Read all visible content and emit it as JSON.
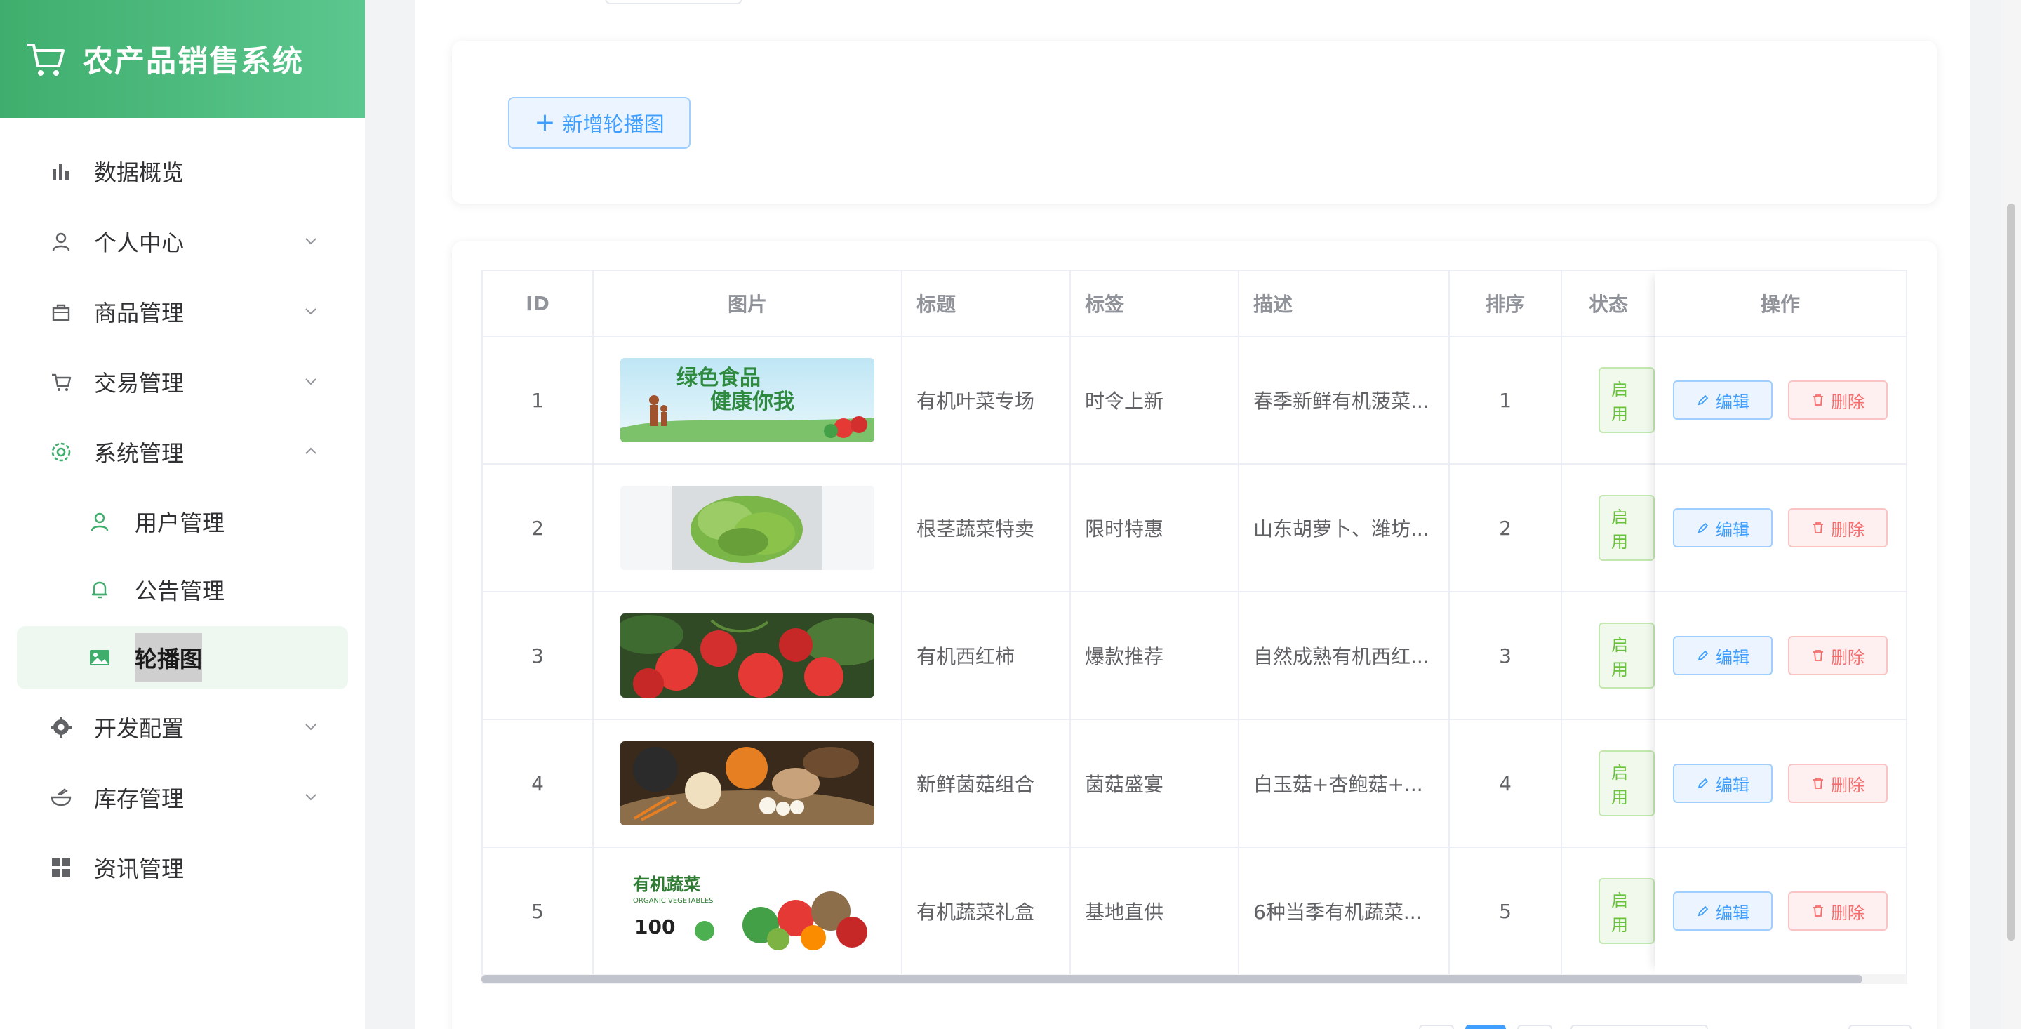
{
  "app": {
    "title": "农产品销售系统"
  },
  "sidebar": {
    "items": [
      {
        "label": "数据概览",
        "icon": "bar-chart-icon",
        "expandable": false
      },
      {
        "label": "个人中心",
        "icon": "user-icon",
        "expandable": true
      },
      {
        "label": "商品管理",
        "icon": "bag-icon",
        "expandable": true
      },
      {
        "label": "交易管理",
        "icon": "cart-icon",
        "expandable": true
      },
      {
        "label": "系统管理",
        "icon": "gear-icon",
        "expandable": true,
        "expanded": true,
        "children": [
          {
            "label": "用户管理",
            "icon": "user-icon"
          },
          {
            "label": "公告管理",
            "icon": "bell-icon"
          },
          {
            "label": "轮播图",
            "icon": "image-icon",
            "active": true
          }
        ]
      },
      {
        "label": "开发配置",
        "icon": "gear-icon",
        "expandable": true
      },
      {
        "label": "库存管理",
        "icon": "bowl-icon",
        "expandable": true
      },
      {
        "label": "资讯管理",
        "icon": "grid-icon",
        "expandable": false
      }
    ]
  },
  "toolbar": {
    "add_label": "新增轮播图"
  },
  "table": {
    "headers": {
      "id": "ID",
      "image": "图片",
      "title": "标题",
      "tag": "标签",
      "desc": "描述",
      "sort": "排序",
      "status": "状态",
      "actions": "操作"
    },
    "rows": [
      {
        "id": "1",
        "image": "绿色食品 健康你我",
        "title": "有机叶菜专场",
        "tag": "时令上新",
        "desc": "春季新鲜有机菠菜...",
        "sort": "1",
        "status": "启用"
      },
      {
        "id": "2",
        "image": "lettuce",
        "title": "根茎蔬菜特卖",
        "tag": "限时特惠",
        "desc": "山东胡萝卜、潍坊...",
        "sort": "2",
        "status": "启用"
      },
      {
        "id": "3",
        "image": "tomatoes",
        "title": "有机西红柿",
        "tag": "爆款推荐",
        "desc": "自然成熟有机西红...",
        "sort": "3",
        "status": "启用"
      },
      {
        "id": "4",
        "image": "mushrooms",
        "title": "新鲜菌菇组合",
        "tag": "菌菇盛宴",
        "desc": "白玉菇+杏鲍菇+...",
        "sort": "4",
        "status": "启用"
      },
      {
        "id": "5",
        "image": "有机蔬菜",
        "title": "有机蔬菜礼盒",
        "tag": "基地直供",
        "desc": "6种当季有机蔬菜...",
        "sort": "5",
        "status": "启用"
      }
    ],
    "edit_label": "编辑",
    "delete_label": "删除"
  },
  "banners": {
    "b1": {
      "line1": "绿色食品",
      "line2": "健康你我"
    },
    "b5": {
      "title": "有机蔬菜",
      "sub": "ORGANIC VEGETABLES",
      "num": "100"
    }
  },
  "colors": {
    "brand": "#3fae6d",
    "primary": "#409eff",
    "danger": "#f56c6c",
    "success": "#67c23a"
  }
}
